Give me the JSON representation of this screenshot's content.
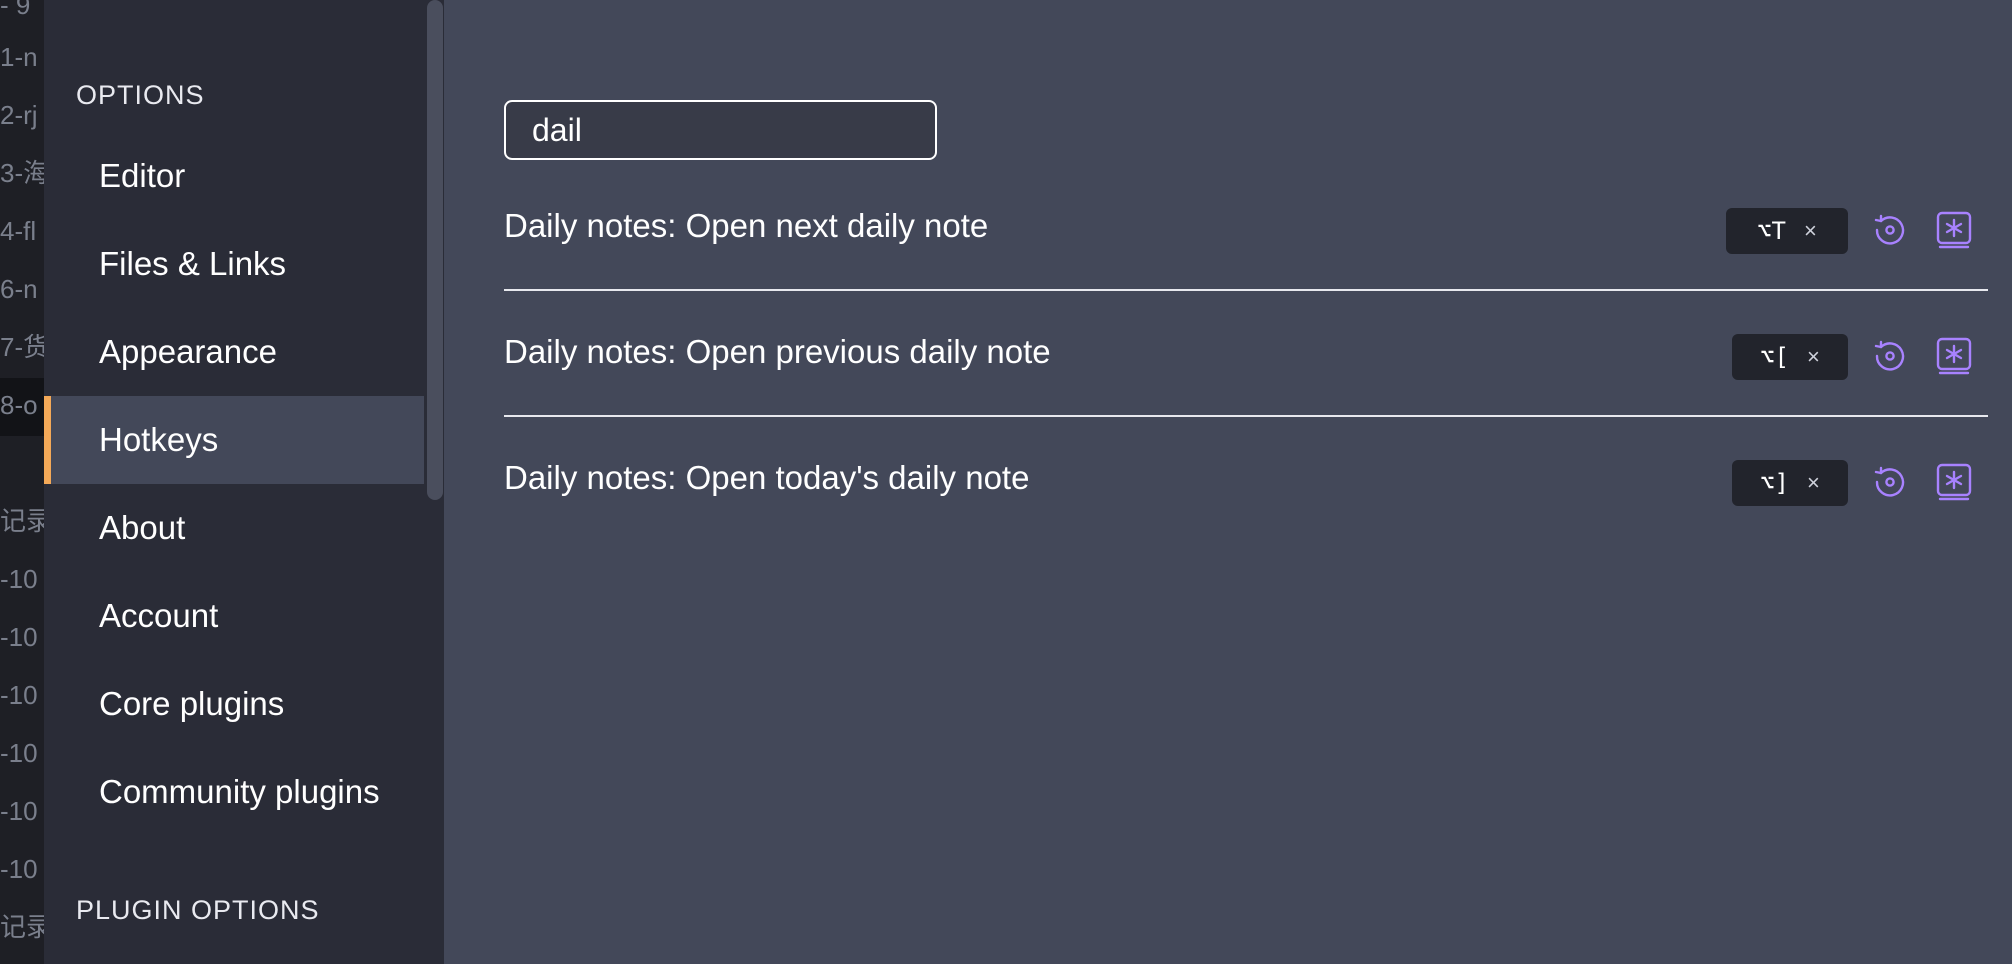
{
  "background_fragments": [
    "- 9",
    "1-n",
    "2-rj",
    "3-海",
    "4-fl",
    "6-n",
    "7-货",
    "8-o",
    "记录",
    "-10",
    "-10",
    "-10",
    "-10",
    "-10",
    "-10",
    "记录"
  ],
  "sidebar": {
    "options_heading": "OPTIONS",
    "items": [
      {
        "label": "Editor"
      },
      {
        "label": "Files & Links"
      },
      {
        "label": "Appearance"
      },
      {
        "label": "Hotkeys",
        "active": true
      },
      {
        "label": "About"
      },
      {
        "label": "Account"
      },
      {
        "label": "Core plugins"
      },
      {
        "label": "Community plugins"
      }
    ],
    "plugin_options_heading": "PLUGIN OPTIONS"
  },
  "search": {
    "value": "dail"
  },
  "hotkeys": [
    {
      "command": "Daily notes: Open next daily note",
      "keys": "⌥T",
      "remove": "×"
    },
    {
      "command": "Daily notes: Open previous daily note",
      "keys": "⌥[",
      "remove": "×"
    },
    {
      "command": "Daily notes: Open today's daily note",
      "keys": "⌥]",
      "remove": "×"
    }
  ],
  "colors": {
    "accent": "#a882ff",
    "active_indicator": "#f4a958",
    "main_bg": "#434859",
    "sidebar_bg": "#2a2c37"
  },
  "icons": {
    "restore": "restore-default-icon",
    "add": "add-hotkey-icon"
  }
}
